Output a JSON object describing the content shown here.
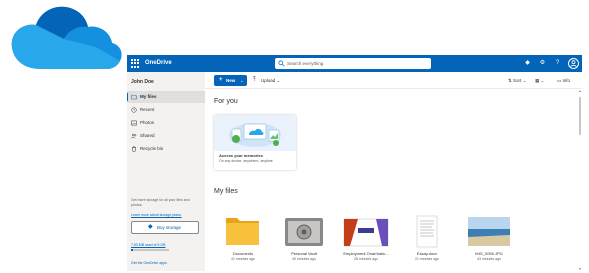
{
  "brand": {
    "accent": "#0364b8",
    "logo_icon": "onedrive-cloud-logo"
  },
  "topbar": {
    "app_name": "OneDrive",
    "search_placeholder": "Search everything",
    "icons": [
      "waffle-icon",
      "search-icon",
      "diamond-icon",
      "gear-icon",
      "help-icon",
      "avatar"
    ],
    "settings": "⚙",
    "help": "?",
    "premium": "◆"
  },
  "sidebar": {
    "user_name": "John Doe",
    "items": [
      {
        "label": "My files",
        "icon": "folder-icon",
        "active": true
      },
      {
        "label": "Recent",
        "icon": "clock-icon",
        "active": false
      },
      {
        "label": "Photos",
        "icon": "image-icon",
        "active": false
      },
      {
        "label": "Shared",
        "icon": "people-icon",
        "active": false
      },
      {
        "label": "Recycle bin",
        "icon": "trash-icon",
        "active": false
      }
    ],
    "promo_text": "Get more storage for all your files and photos.",
    "promo_link": "Learn more about storage plans.",
    "buy_storage": "Buy storage",
    "storage_text": "7.53 MB used of 5 GB",
    "storage_fraction": 0.05,
    "get_apps": "Get the OneDrive apps"
  },
  "commandbar": {
    "new_label": "New",
    "upload_label": "Upload",
    "sort_label": "Sort",
    "info_label": "Info"
  },
  "main": {
    "for_you_title": "For you",
    "memories_title": "Access your memories",
    "memories_sub": "On any device, anywhere, anytime",
    "my_files_title": "My files",
    "files": [
      {
        "name": "Documents",
        "meta": "41 minutes ago",
        "type": "folder"
      },
      {
        "name": "Personal Vault",
        "meta": "40 minutes ago",
        "type": "vault"
      },
      {
        "name": "Employment Onarrhatic...",
        "meta": "28 minutes ago",
        "type": "presentation"
      },
      {
        "name": "Essay.docx",
        "meta": "21 minutes ago",
        "type": "document"
      },
      {
        "name": "IMG_0055.JPG",
        "meta": "43 minutes ago",
        "type": "image"
      }
    ]
  }
}
